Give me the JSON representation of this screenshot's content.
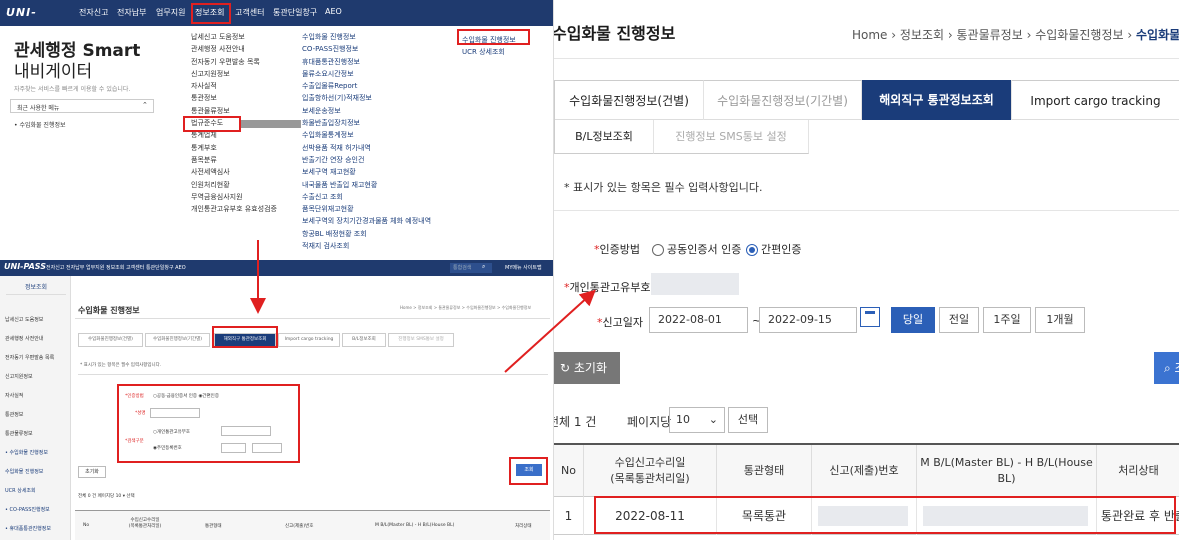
{
  "top_left": {
    "logo": "UNI-PASS",
    "nav": [
      "전자신고",
      "전자납부",
      "업무지원",
      "정보조회",
      "고객센터",
      "통관단일창구",
      "AEO"
    ],
    "title_line1": "관세행정 Smart",
    "title_line2": "내비게이터",
    "subtitle": "자주찾는 서비스를 빠르게 이용할 수 있습니다.",
    "recent_label": "최근 사용한 메뉴",
    "recent_item": "• 수입화물 진행정보",
    "col1": [
      "납세신고 도움정보",
      "관세행정 사전안내",
      "전자동기 우편발송 목록",
      "신고지원정보",
      "자사실적",
      "통관정보",
      "통관물류정보",
      "법규준수도",
      "통계업체",
      "통계부호",
      "품목분류",
      "사전세액심사",
      "인원처리현황",
      "무역금융심사지원",
      "개인통관고유부호 유효성검증"
    ],
    "col2": [
      "수입화물 진행정보",
      "CO-PASS진행정보",
      "휴대품통관진행정보",
      "물류소요시간정보",
      "수출입물류Report",
      "입출항하선(기)적재정보",
      "보세운송정보",
      "화물반출입장치정보",
      "수입화물통계정보",
      "선박용품 적재 허가내역",
      "반출기간 연장 승인건",
      "보세구역 재고현황",
      "내국물품 반출입 재고현황",
      "수출신고 조회",
      "품목단위재고현황",
      "보세구역외 장치기간경과물품 체화 예정내역",
      "항공BL 배정현황 조회",
      "적재지 검사조회"
    ],
    "col3": [
      "수입화물 진행정보",
      "UCR 상세조회"
    ]
  },
  "bottom_left": {
    "logo": "UNI-PASS",
    "menu": "전자신고  전자납부  업무지원  정보조회  고객센터  통관단일창구  AEO",
    "search_placeholder": "통합검색",
    "right_menu": "MY메뉴  사이트맵",
    "side_header": "정보조회",
    "side_items": [
      "납세신고 도움정보",
      "관세행정 사전안내",
      "전자동기 우편발송 목록",
      "신고지원정보",
      "자사실적",
      "통관정보",
      "통관물류정보",
      "• 수입화물 진행정보",
      "수입화물 진행정보",
      "UCR 상세조회",
      "• CO-PASS진행정보",
      "• 휴대품통관진행정보"
    ],
    "title": "수입화물 진행정보",
    "crumb": "Home > 정보조회 > 통관물류정보 > 수입화물진행정보 > 수입화물진행정보",
    "tabs": [
      "수입화물진행정보(건별)",
      "수입화물진행정보(기간별)",
      "해외직구 통관정보조회",
      "Import cargo tracking",
      "B/L정보조회",
      "진행정보 SMS통보 설정"
    ],
    "note": "* 표시가 있는 항목은 필수 입력사항입니다.",
    "auth_label": "*인증방법",
    "auth_opts": "○공동·금융인증서 인증  ◉간편인증",
    "name_label": "*성명",
    "id_label": "*검색구분",
    "id_opt1": "○개인통관고유부호",
    "id_opt2": "◉주민등록번호",
    "reset": "초기화",
    "query": "조회",
    "count": "전체 0 건    페이지당  10  ▾  선택",
    "th": [
      "No",
      "수입신고수리일\n(목록통관처리일)",
      "통관형태",
      "신고(제출)번호",
      "M B/L(Master BL) - H B/L(House BL)",
      "처리상태"
    ]
  },
  "right": {
    "title": "수입화물 진행정보",
    "crumb": [
      "Home",
      "정보조회",
      "통관물류정보",
      "수입화물진행정보",
      "수입화물진행정"
    ],
    "tabs1": [
      "수입화물진행정보(건별)",
      "수입화물진행정보(기간별)",
      "해외직구 통관정보조회",
      "Import cargo tracking"
    ],
    "tabs2": [
      "B/L정보조회",
      "진행정보 SMS통보 설정"
    ],
    "note": "* 표시가 있는 항목은 필수 입력사항입니다.",
    "auth_label": "인증방법",
    "auth_opt1": "공동인증서 인증",
    "auth_opt2": "간편인증",
    "pcc_label": "개인통관고유부호",
    "date_label": "신고일자",
    "date_from": "2022-08-01",
    "date_sep": "~",
    "date_to": "2022-09-15",
    "date_buttons": [
      "당일",
      "전일",
      "1주일",
      "1개월"
    ],
    "reset": "초기화",
    "query": "조회",
    "count": "전체 1 건",
    "per_page_label": "페이지당",
    "per_page": "10",
    "select_btn": "선택",
    "th": [
      "No",
      "수입신고수리일\n(목록통관처리일)",
      "통관형태",
      "신고(제출)번호",
      "M B/L(Master BL) - H B/L(House BL)",
      "처리상태"
    ],
    "row": {
      "no": "1",
      "date": "2022-08-11",
      "type": "목록통관",
      "status": "통관완료 후 반출"
    }
  },
  "colors": {
    "accent_red": "#e02020",
    "navy": "#1f3a6e",
    "tab_blue": "#1a3c7a",
    "button_blue": "#2b5fb7"
  }
}
